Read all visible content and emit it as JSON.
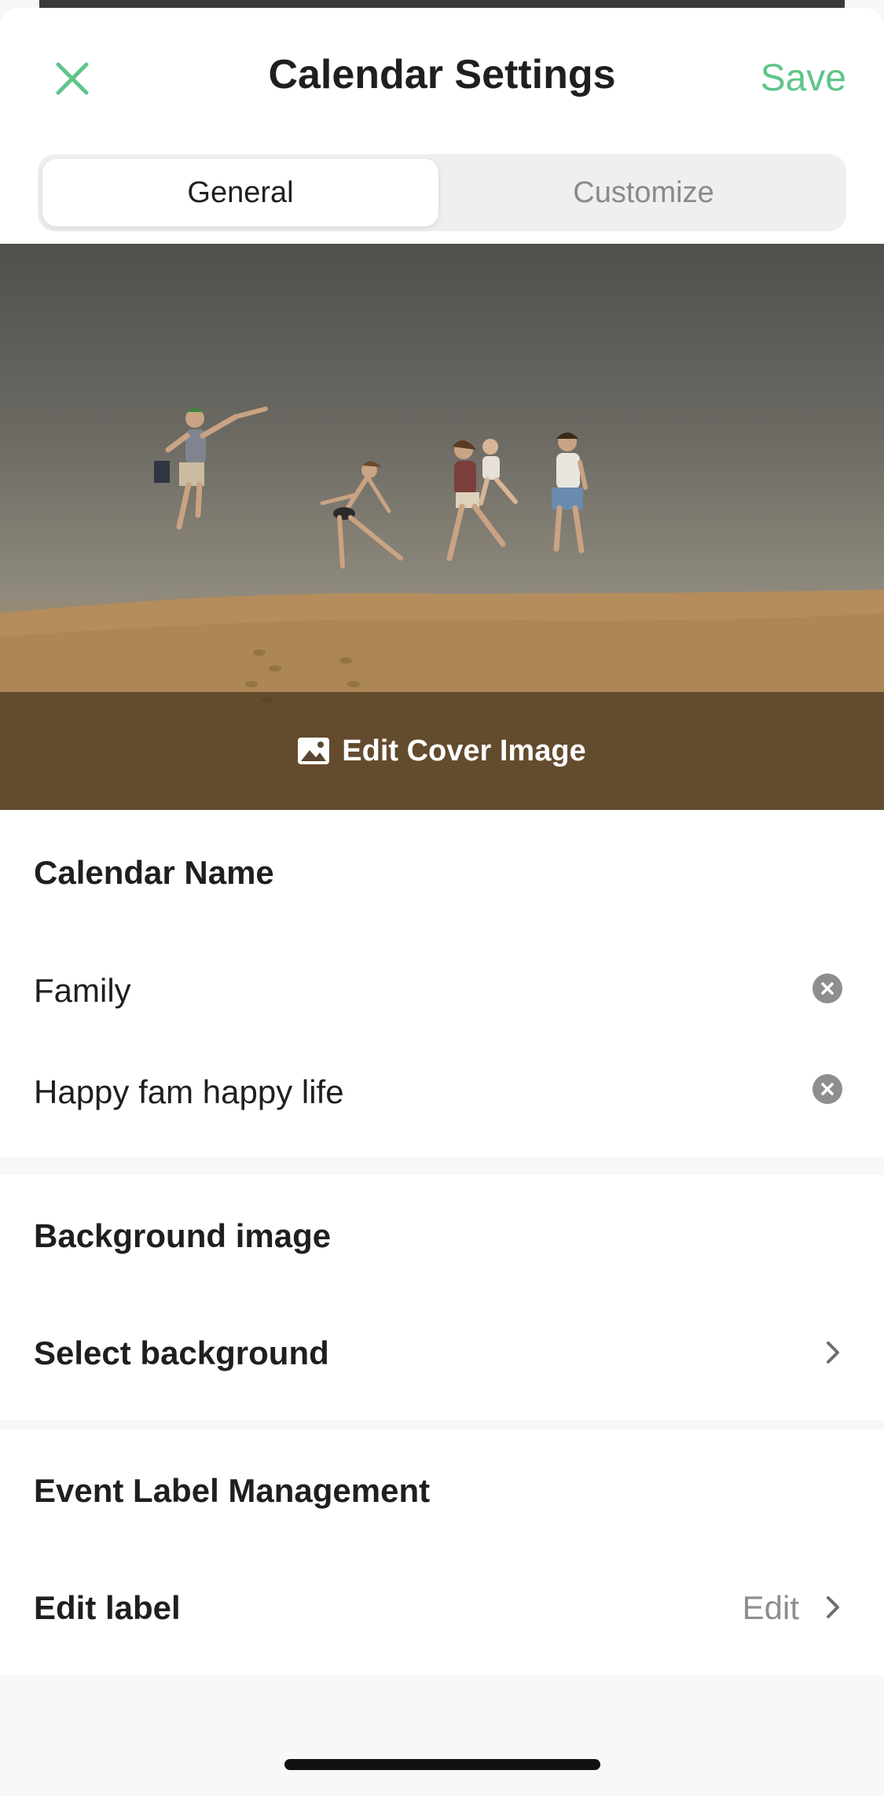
{
  "header": {
    "title": "Calendar Settings",
    "save_label": "Save",
    "close_icon": "close-icon",
    "accent_color": "#5ec589"
  },
  "tabs": [
    {
      "label": "General",
      "selected": true
    },
    {
      "label": "Customize",
      "selected": false
    }
  ],
  "cover": {
    "edit_label": "Edit Cover Image",
    "icon": "image-icon"
  },
  "calendar_name": {
    "section_title": "Calendar Name",
    "name_value": "Family",
    "description_value": "Happy fam happy life"
  },
  "background": {
    "section_title": "Background image",
    "select_label": "Select background"
  },
  "labels": {
    "section_title": "Event Label Management",
    "edit_label_text": "Edit label",
    "edit_action": "Edit"
  }
}
